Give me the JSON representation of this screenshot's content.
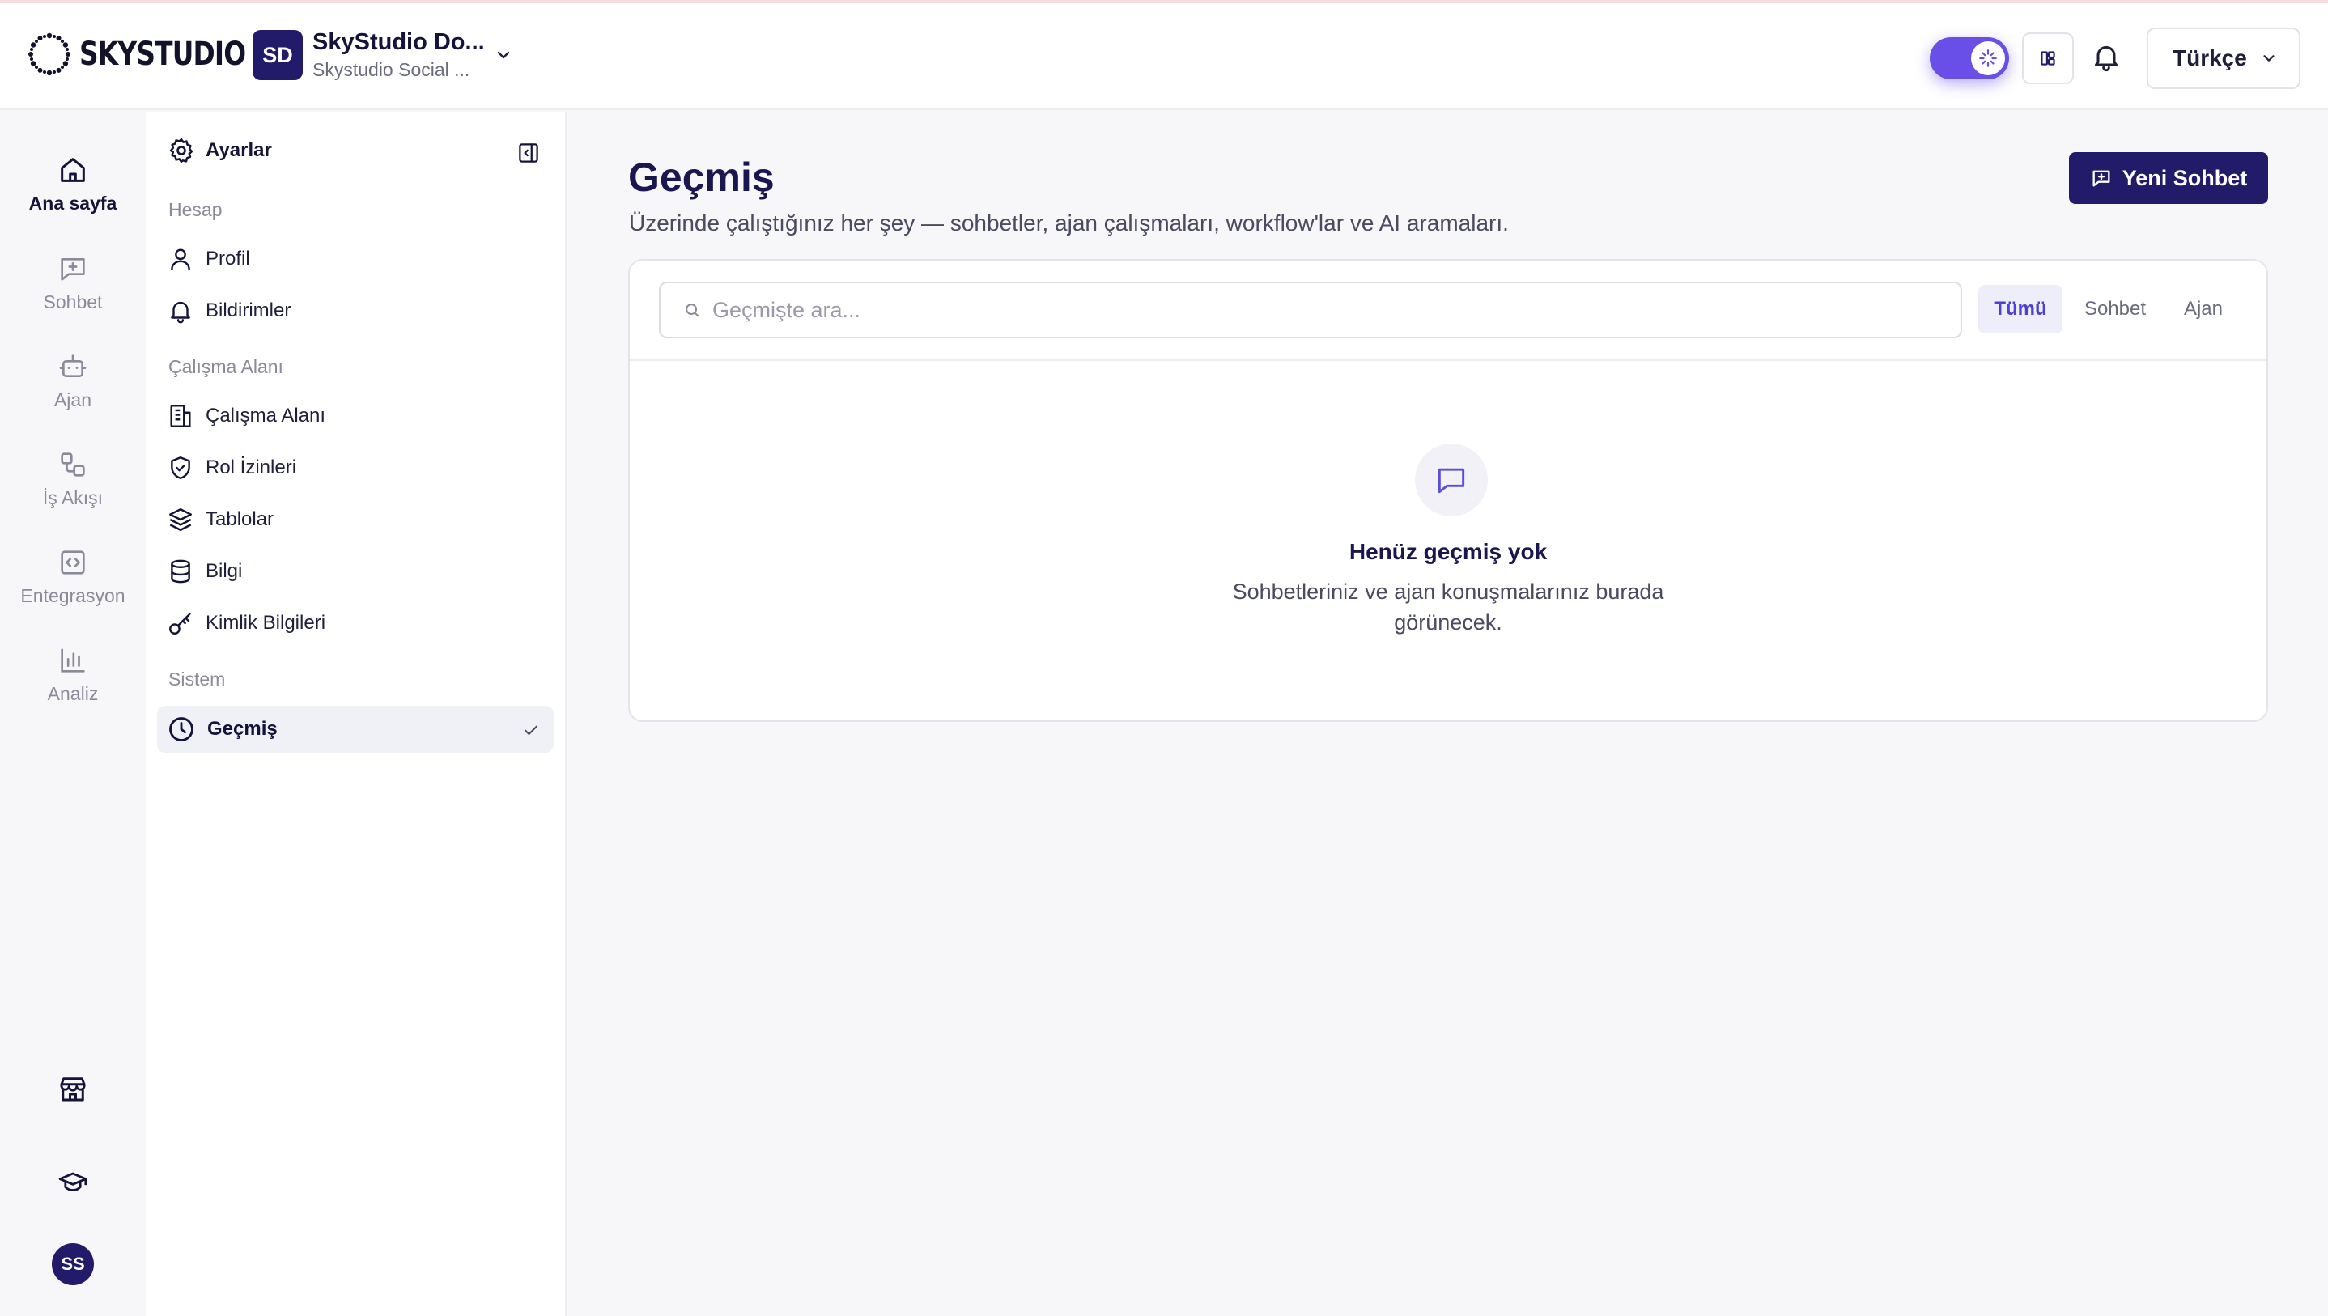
{
  "colors": {
    "accent": "#211b6a",
    "toggle": "#6a4ee8",
    "active_filter_text": "#4b3fd4"
  },
  "header": {
    "logo_text": "SKYSTUDIO",
    "workspace": {
      "initials": "SD",
      "name": "SkyStudio Do...",
      "subtitle": "Skystudio Social ..."
    },
    "language": "Türkçe",
    "icons": [
      "sparkle-icon",
      "layout-icon",
      "bell-icon",
      "chevron-down-icon"
    ]
  },
  "rail": {
    "items": [
      {
        "label": "Ana sayfa",
        "icon": "home-icon",
        "active": true
      },
      {
        "label": "Sohbet",
        "icon": "chat-plus-icon"
      },
      {
        "label": "Ajan",
        "icon": "bot-icon"
      },
      {
        "label": "İş Akışı",
        "icon": "workflow-icon"
      },
      {
        "label": "Entegrasyon",
        "icon": "code-icon"
      },
      {
        "label": "Analiz",
        "icon": "bar-chart-icon"
      }
    ],
    "bottom": [
      "store-icon",
      "graduation-cap-icon"
    ],
    "avatar": "SS"
  },
  "sidebar": {
    "title": "Ayarlar",
    "sections": [
      {
        "label": "Hesap"
      },
      {
        "label": "Çalışma Alanı"
      },
      {
        "label": "Sistem"
      }
    ],
    "items": [
      {
        "label": "Profil",
        "icon": "user-icon"
      },
      {
        "label": "Bildirimler",
        "icon": "bell-icon"
      },
      {
        "label": "Çalışma Alanı",
        "icon": "building-icon"
      },
      {
        "label": "Rol İzinleri",
        "icon": "shield-check-icon"
      },
      {
        "label": "Tablolar",
        "icon": "layers-icon"
      },
      {
        "label": "Bilgi",
        "icon": "database-icon"
      },
      {
        "label": "Kimlik Bilgileri",
        "icon": "key-icon"
      },
      {
        "label": "Geçmiş",
        "icon": "clock-icon",
        "active": true
      }
    ]
  },
  "main": {
    "title": "Geçmiş",
    "subtitle": "Üzerinde çalıştığınız her şey — sohbetler, ajan çalışmaları, workflow'lar ve AI aramaları.",
    "new_chat_label": "Yeni Sohbet",
    "search": {
      "placeholder": "Geçmişte ara...",
      "value": ""
    },
    "filters": [
      {
        "label": "Tümü",
        "active": true
      },
      {
        "label": "Sohbet"
      },
      {
        "label": "Ajan"
      }
    ],
    "empty": {
      "title": "Henüz geçmiş yok",
      "text": "Sohbetleriniz ve ajan konuşmalarınız burada görünecek."
    }
  }
}
